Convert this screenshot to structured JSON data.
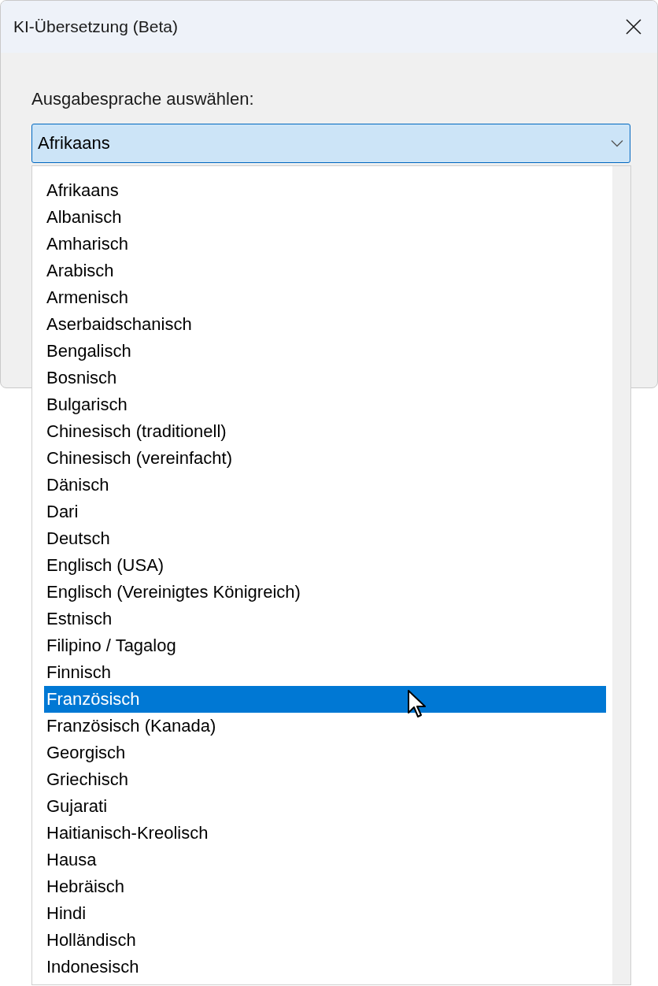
{
  "window": {
    "title": "KI-Übersetzung (Beta)"
  },
  "language_label": "Ausgabesprache auswählen:",
  "language_select": {
    "value": "Afrikaans",
    "expanded": true
  },
  "options": [
    {
      "label": "Afrikaans",
      "selected": false
    },
    {
      "label": "Albanisch",
      "selected": false
    },
    {
      "label": "Amharisch",
      "selected": false
    },
    {
      "label": "Arabisch",
      "selected": false
    },
    {
      "label": "Armenisch",
      "selected": false
    },
    {
      "label": "Aserbaidschanisch",
      "selected": false
    },
    {
      "label": "Bengalisch",
      "selected": false
    },
    {
      "label": "Bosnisch",
      "selected": false
    },
    {
      "label": "Bulgarisch",
      "selected": false
    },
    {
      "label": "Chinesisch (traditionell)",
      "selected": false
    },
    {
      "label": "Chinesisch (vereinfacht)",
      "selected": false
    },
    {
      "label": "Dänisch",
      "selected": false
    },
    {
      "label": "Dari",
      "selected": false
    },
    {
      "label": "Deutsch",
      "selected": false
    },
    {
      "label": "Englisch (USA)",
      "selected": false
    },
    {
      "label": "Englisch (Vereinigtes Königreich)",
      "selected": false
    },
    {
      "label": "Estnisch",
      "selected": false
    },
    {
      "label": "Filipino / Tagalog",
      "selected": false
    },
    {
      "label": "Finnisch",
      "selected": false
    },
    {
      "label": "Französisch",
      "selected": true
    },
    {
      "label": "Französisch (Kanada)",
      "selected": false
    },
    {
      "label": "Georgisch",
      "selected": false
    },
    {
      "label": "Griechisch",
      "selected": false
    },
    {
      "label": "Gujarati",
      "selected": false
    },
    {
      "label": "Haitianisch-Kreolisch",
      "selected": false
    },
    {
      "label": "Hausa",
      "selected": false
    },
    {
      "label": "Hebräisch",
      "selected": false
    },
    {
      "label": "Hindi",
      "selected": false
    },
    {
      "label": "Holländisch",
      "selected": false
    },
    {
      "label": "Indonesisch",
      "selected": false
    }
  ]
}
